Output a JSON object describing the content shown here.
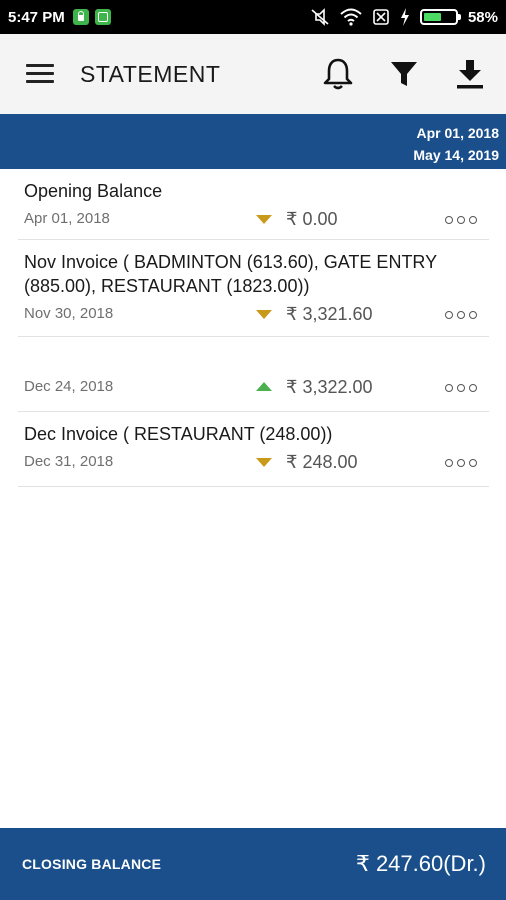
{
  "status_bar": {
    "time": "5:47 PM",
    "battery_text": "58%",
    "battery_level": 0.58,
    "icons": [
      "lock-icon",
      "square-icon",
      "mute-icon",
      "wifi-icon",
      "sim-off-icon",
      "charging-icon",
      "battery-icon"
    ]
  },
  "header": {
    "title": "STATEMENT",
    "icons": [
      "menu-icon",
      "bell-icon",
      "filter-icon",
      "download-icon"
    ]
  },
  "date_range": {
    "from": "Apr 01, 2018",
    "to": "May 14, 2019"
  },
  "transactions": [
    {
      "title": "Opening Balance",
      "date": "Apr 01, 2018",
      "direction": "down",
      "amount": "₹ 0.00"
    },
    {
      "title": "Nov Invoice (  BADMINTON  (613.60), GATE ENTRY (885.00), RESTAURANT (1823.00))",
      "date": "Nov 30, 2018",
      "direction": "down",
      "amount": "₹ 3,321.60"
    },
    {
      "title": "",
      "date": "Dec 24, 2018",
      "direction": "up",
      "amount": "₹ 3,322.00"
    },
    {
      "title": "Dec Invoice ( RESTAURANT (248.00))",
      "date": "Dec 31, 2018",
      "direction": "down",
      "amount": "₹ 248.00"
    }
  ],
  "footer": {
    "label": "CLOSING BALANCE",
    "value": "₹ 247.60(Dr.)"
  },
  "colors": {
    "brand_blue": "#1a4f8b",
    "debit_arrow": "#c99a1a",
    "credit_arrow": "#4caf50"
  }
}
